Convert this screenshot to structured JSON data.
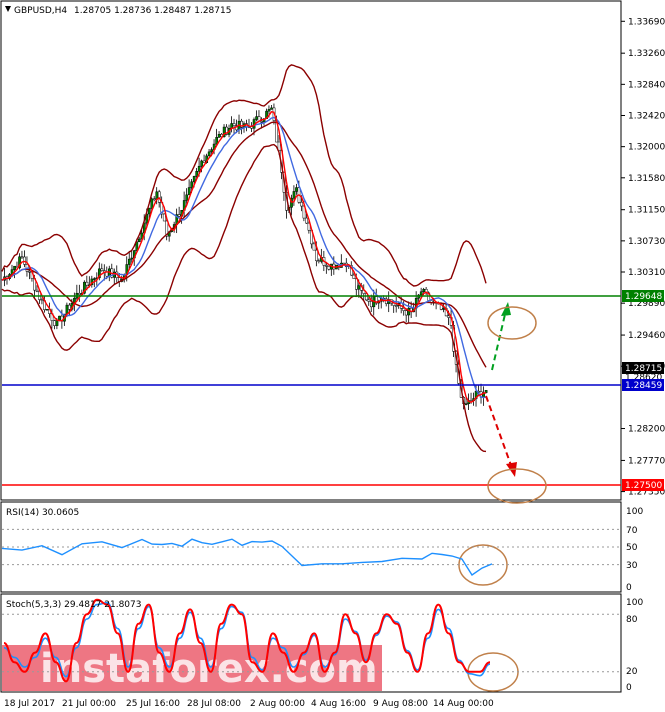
{
  "header": {
    "symbol_label": "GBPUSD,H4",
    "ohlc": "1.28705 1.28736 1.28487 1.28715"
  },
  "rsi_panel": {
    "label": "RSI(14) 30.0605",
    "scale": [
      "100",
      "70",
      "50",
      "30",
      "0"
    ]
  },
  "stoch_panel": {
    "label": "Stoch(5,3,3) 29.4817 21.8073",
    "scale": [
      "100",
      "80",
      "20",
      "0"
    ]
  },
  "watermark": "instaforex.com",
  "colors": {
    "support": "#0000cc",
    "resistance": "#008000",
    "target": "#ff0000",
    "bollinger": "#8b0000",
    "ma_fast": "#ff0000",
    "ma_slow": "#4169e1",
    "bull_candle": "#008000",
    "rsi_line": "#1e90ff",
    "stoch_main": "#ff0000",
    "stoch_signal": "#1e90ff",
    "circle": "#c0804a"
  },
  "chart_data": [
    {
      "type": "candlestick",
      "symbol": "GBPUSD",
      "timeframe": "H4",
      "price_ticks": [
        1.3369,
        1.3326,
        1.3284,
        1.3242,
        1.32,
        1.3158,
        1.3115,
        1.3073,
        1.3031,
        1.2989,
        1.2946,
        1.2904,
        1.282,
        1.2777,
        1.2735
      ],
      "x_labels": [
        "18 Jul 2017",
        "21 Jul 00:00",
        "25 Jul 16:00",
        "28 Jul 08:00",
        "2 Aug 00:00",
        "4 Aug 16:00",
        "9 Aug 08:00",
        "14 Aug 00:00"
      ],
      "ylim": [
        1.2725,
        1.3395
      ],
      "close_path": [
        [
          0,
          1.302
        ],
        [
          8,
          1.305
        ],
        [
          16,
          1.299
        ],
        [
          22,
          1.296
        ],
        [
          30,
          1.3
        ],
        [
          40,
          1.3035
        ],
        [
          48,
          1.302
        ],
        [
          56,
          1.309
        ],
        [
          62,
          1.314
        ],
        [
          66,
          1.308
        ],
        [
          74,
          1.313
        ],
        [
          80,
          1.318
        ],
        [
          86,
          1.321
        ],
        [
          92,
          1.323
        ],
        [
          98,
          1.3225
        ],
        [
          104,
          1.324
        ],
        [
          108,
          1.325
        ],
        [
          112,
          1.317
        ],
        [
          114,
          1.312
        ],
        [
          118,
          1.314
        ],
        [
          122,
          1.31
        ],
        [
          126,
          1.305
        ],
        [
          132,
          1.304
        ],
        [
          138,
          1.3045
        ],
        [
          142,
          1.301
        ],
        [
          148,
          1.299
        ],
        [
          152,
          1.3
        ],
        [
          158,
          1.2985
        ],
        [
          164,
          1.2975
        ],
        [
          168,
          1.3005
        ],
        [
          172,
          1.299
        ],
        [
          176,
          1.298
        ],
        [
          180,
          1.296
        ],
        [
          182,
          1.29
        ],
        [
          184,
          1.286
        ],
        [
          186,
          1.285
        ],
        [
          190,
          1.2865
        ],
        [
          194,
          1.2872
        ]
      ],
      "levels": [
        {
          "name": "resistance",
          "value": "1.29648"
        },
        {
          "name": "current",
          "value": "1.28715"
        },
        {
          "name": "prev",
          "value": "1.28620"
        },
        {
          "name": "support",
          "value": "1.28459"
        },
        {
          "name": "target",
          "value": "1.27500"
        }
      ]
    },
    {
      "type": "line",
      "name": "RSI(14)",
      "ylim": [
        0,
        100
      ],
      "levels": [
        30,
        50,
        70
      ],
      "path": [
        [
          0,
          48
        ],
        [
          20,
          45
        ],
        [
          40,
          50
        ],
        [
          60,
          42
        ],
        [
          80,
          55
        ],
        [
          100,
          55
        ],
        [
          120,
          50
        ],
        [
          140,
          58
        ],
        [
          150,
          52
        ],
        [
          160,
          54
        ],
        [
          170,
          55
        ],
        [
          180,
          50
        ],
        [
          190,
          60
        ],
        [
          200,
          56
        ],
        [
          210,
          52
        ],
        [
          220,
          55
        ],
        [
          230,
          58
        ],
        [
          240,
          52
        ],
        [
          250,
          56
        ],
        [
          260,
          55
        ],
        [
          270,
          58
        ],
        [
          280,
          50
        ],
        [
          300,
          30
        ],
        [
          320,
          32
        ],
        [
          340,
          30
        ],
        [
          360,
          32
        ],
        [
          380,
          35
        ],
        [
          400,
          38
        ],
        [
          420,
          36
        ],
        [
          430,
          44
        ],
        [
          440,
          42
        ],
        [
          450,
          40
        ],
        [
          460,
          35
        ],
        [
          470,
          18
        ],
        [
          480,
          26
        ],
        [
          490,
          30
        ]
      ]
    },
    {
      "type": "line",
      "name": "Stoch(5,3,3)",
      "ylim": [
        0,
        100
      ],
      "levels": [
        20,
        80
      ],
      "series": [
        {
          "name": "main",
          "values": [
            50,
            30,
            20,
            40,
            60,
            30,
            10,
            50,
            80,
            95,
            90,
            60,
            20,
            70,
            90,
            40,
            20,
            60,
            85,
            50,
            20,
            70,
            90,
            80,
            30,
            20,
            60,
            40,
            20,
            40,
            60,
            20,
            40,
            80,
            60,
            30,
            60,
            80,
            70,
            40,
            20,
            60,
            90,
            60,
            30,
            20,
            20,
            30
          ]
        },
        {
          "name": "signal",
          "values": [
            45,
            35,
            25,
            35,
            55,
            35,
            15,
            45,
            75,
            90,
            92,
            65,
            25,
            65,
            88,
            45,
            25,
            55,
            82,
            55,
            25,
            65,
            88,
            82,
            35,
            22,
            55,
            45,
            25,
            38,
            58,
            25,
            38,
            75,
            62,
            32,
            58,
            78,
            72,
            42,
            22,
            55,
            85,
            65,
            32,
            18,
            16,
            28
          ]
        }
      ]
    }
  ]
}
